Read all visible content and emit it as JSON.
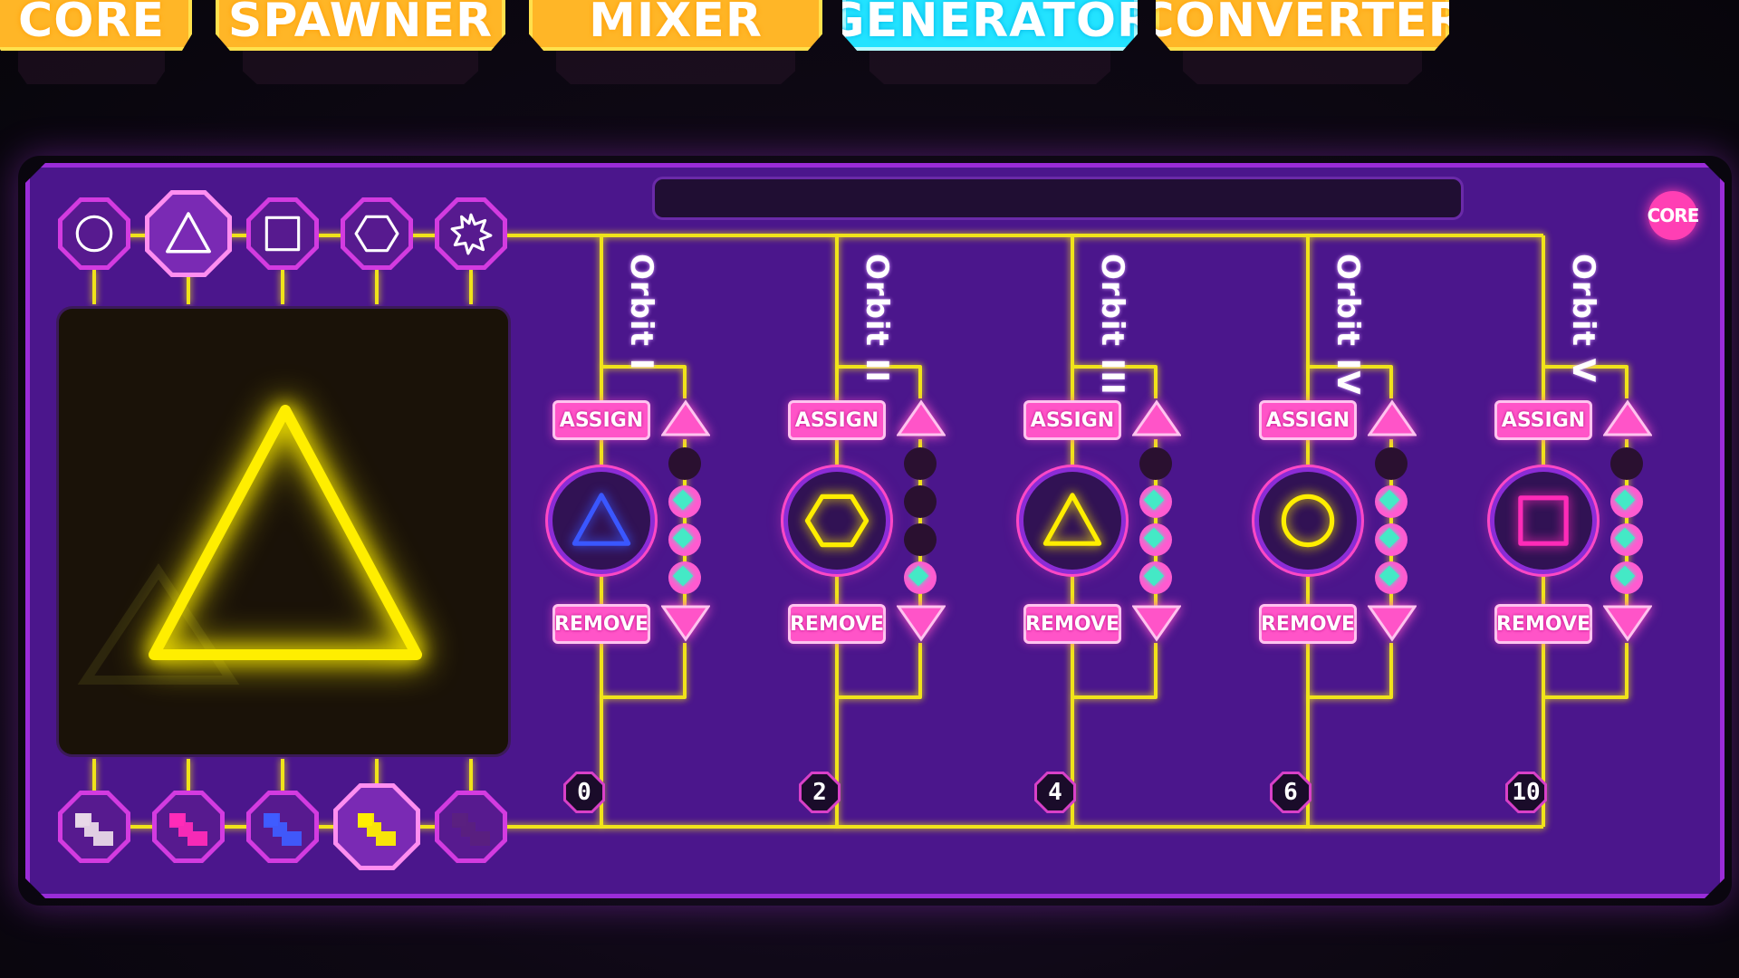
{
  "tabs": [
    {
      "label": "CORE",
      "active": false
    },
    {
      "label": "SPAWNER",
      "active": false
    },
    {
      "label": "MIXER",
      "active": false
    },
    {
      "label": "GENERATOR",
      "active": true
    },
    {
      "label": "CONVERTER",
      "active": false
    }
  ],
  "core_badge": "CORE",
  "shape_selector": [
    {
      "icon": "circle-icon",
      "selected": false
    },
    {
      "icon": "triangle-icon",
      "selected": true
    },
    {
      "icon": "square-icon",
      "selected": false
    },
    {
      "icon": "hexagon-icon",
      "selected": false
    },
    {
      "icon": "star-icon",
      "selected": false
    }
  ],
  "color_selector": [
    {
      "icon": "white-swatch-icon",
      "color": "#e8d8e8",
      "selected": false
    },
    {
      "icon": "magenta-swatch-icon",
      "color": "#ff2bb8",
      "selected": false
    },
    {
      "icon": "blue-swatch-icon",
      "color": "#3f5cff",
      "selected": false
    },
    {
      "icon": "yellow-swatch-icon",
      "color": "#ffee00",
      "selected": true
    },
    {
      "icon": "purple-swatch-icon",
      "color": "#5a2080",
      "selected": false
    }
  ],
  "preview": {
    "shape": "triangle",
    "color": "#ffee00"
  },
  "orbits": [
    {
      "name": "Orbit I",
      "assign": "ASSIGN",
      "remove": "REMOVE",
      "shape": "triangle",
      "shape_color": "#3a57ff",
      "level": 3,
      "counter": "0"
    },
    {
      "name": "Orbit II",
      "assign": "ASSIGN",
      "remove": "REMOVE",
      "shape": "hexagon",
      "shape_color": "#ffee00",
      "level": 1,
      "counter": "2"
    },
    {
      "name": "Orbit III",
      "assign": "ASSIGN",
      "remove": "REMOVE",
      "shape": "triangle",
      "shape_color": "#ffee00",
      "level": 3,
      "counter": "4"
    },
    {
      "name": "Orbit IV",
      "assign": "ASSIGN",
      "remove": "REMOVE",
      "shape": "circle",
      "shape_color": "#ffee00",
      "level": 3,
      "counter": "6"
    },
    {
      "name": "Orbit V",
      "assign": "ASSIGN",
      "remove": "REMOVE",
      "shape": "square",
      "shape_color": "#ff2bb8",
      "level": 3,
      "counter": "10"
    }
  ],
  "level_max": 4,
  "colors": {
    "wire": "#f0e31a",
    "panel": "#4b168c",
    "accent": "#ff54c8",
    "indicator": "#44e9c6"
  }
}
